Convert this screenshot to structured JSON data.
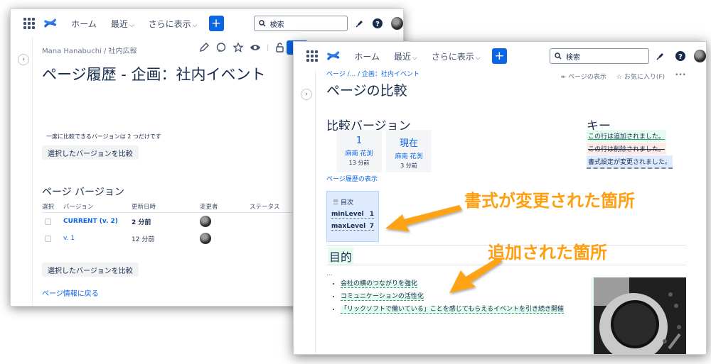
{
  "nav": {
    "home": "ホーム",
    "recent": "最近",
    "more": "さらに表示",
    "search_placeholder": "検索",
    "plus": "+",
    "colors": {
      "brand": "#0c66e4",
      "added": "#e3fcef",
      "deleted": "#ffebe6",
      "format": "#deebff",
      "callout": "#ff9e0f"
    }
  },
  "left": {
    "breadcrumb": "Mana Hanabuchi  /  社内広報",
    "title": "ページ履歴 - 企画：社内イベント",
    "note": "一度に比較できるバージョンは 2 つだけです",
    "compare_button": "選択したバージョンを比較",
    "section_title": "ページ バージョン",
    "columns": [
      "選択",
      "バージョン",
      "更新日時",
      "変更者",
      "ステータス"
    ],
    "rows": [
      {
        "version": "CURRENT (v. 2)",
        "updated": "2 分前"
      },
      {
        "version": "v. 1",
        "updated": "12 分前"
      }
    ],
    "compare_button_bottom": "選択したバージョンを比較",
    "back_link": "ページ情報に戻る"
  },
  "right": {
    "breadcrumb": "ページ /... / 企画：社内イベント",
    "title": "ページの比較",
    "view_page": "ページの表示",
    "favorite": "お気に入り(F)",
    "more": "•••",
    "compare_heading": "比較バージョン",
    "key_heading": "キー",
    "versions": [
      {
        "num": "1",
        "author": "麻南 花渕",
        "ago": "13 分前"
      },
      {
        "num": "現在",
        "author": "麻南 花渕",
        "ago": "3 分前"
      }
    ],
    "key": {
      "added": "この行は追加されました。",
      "deleted": "この行は削除されました。",
      "format": "書式設定が変更されました。"
    },
    "history_link": "ページ履歴の表示",
    "toc": {
      "title": "目次",
      "params": [
        {
          "k": "minLevel",
          "v": "1"
        },
        {
          "k": "maxLevel",
          "v": "7"
        }
      ]
    },
    "purpose_heading": "目的",
    "ellipsis": "...",
    "bullets": [
      "会社の横のつながりを強化",
      "コミュニケーションの活性化",
      "「リックソフトで働いている」ことを感じてもらえるイベントを引き続き開催"
    ]
  },
  "callouts": {
    "format_changed": "書式が変更された箇所",
    "added": "追加された箇所"
  }
}
